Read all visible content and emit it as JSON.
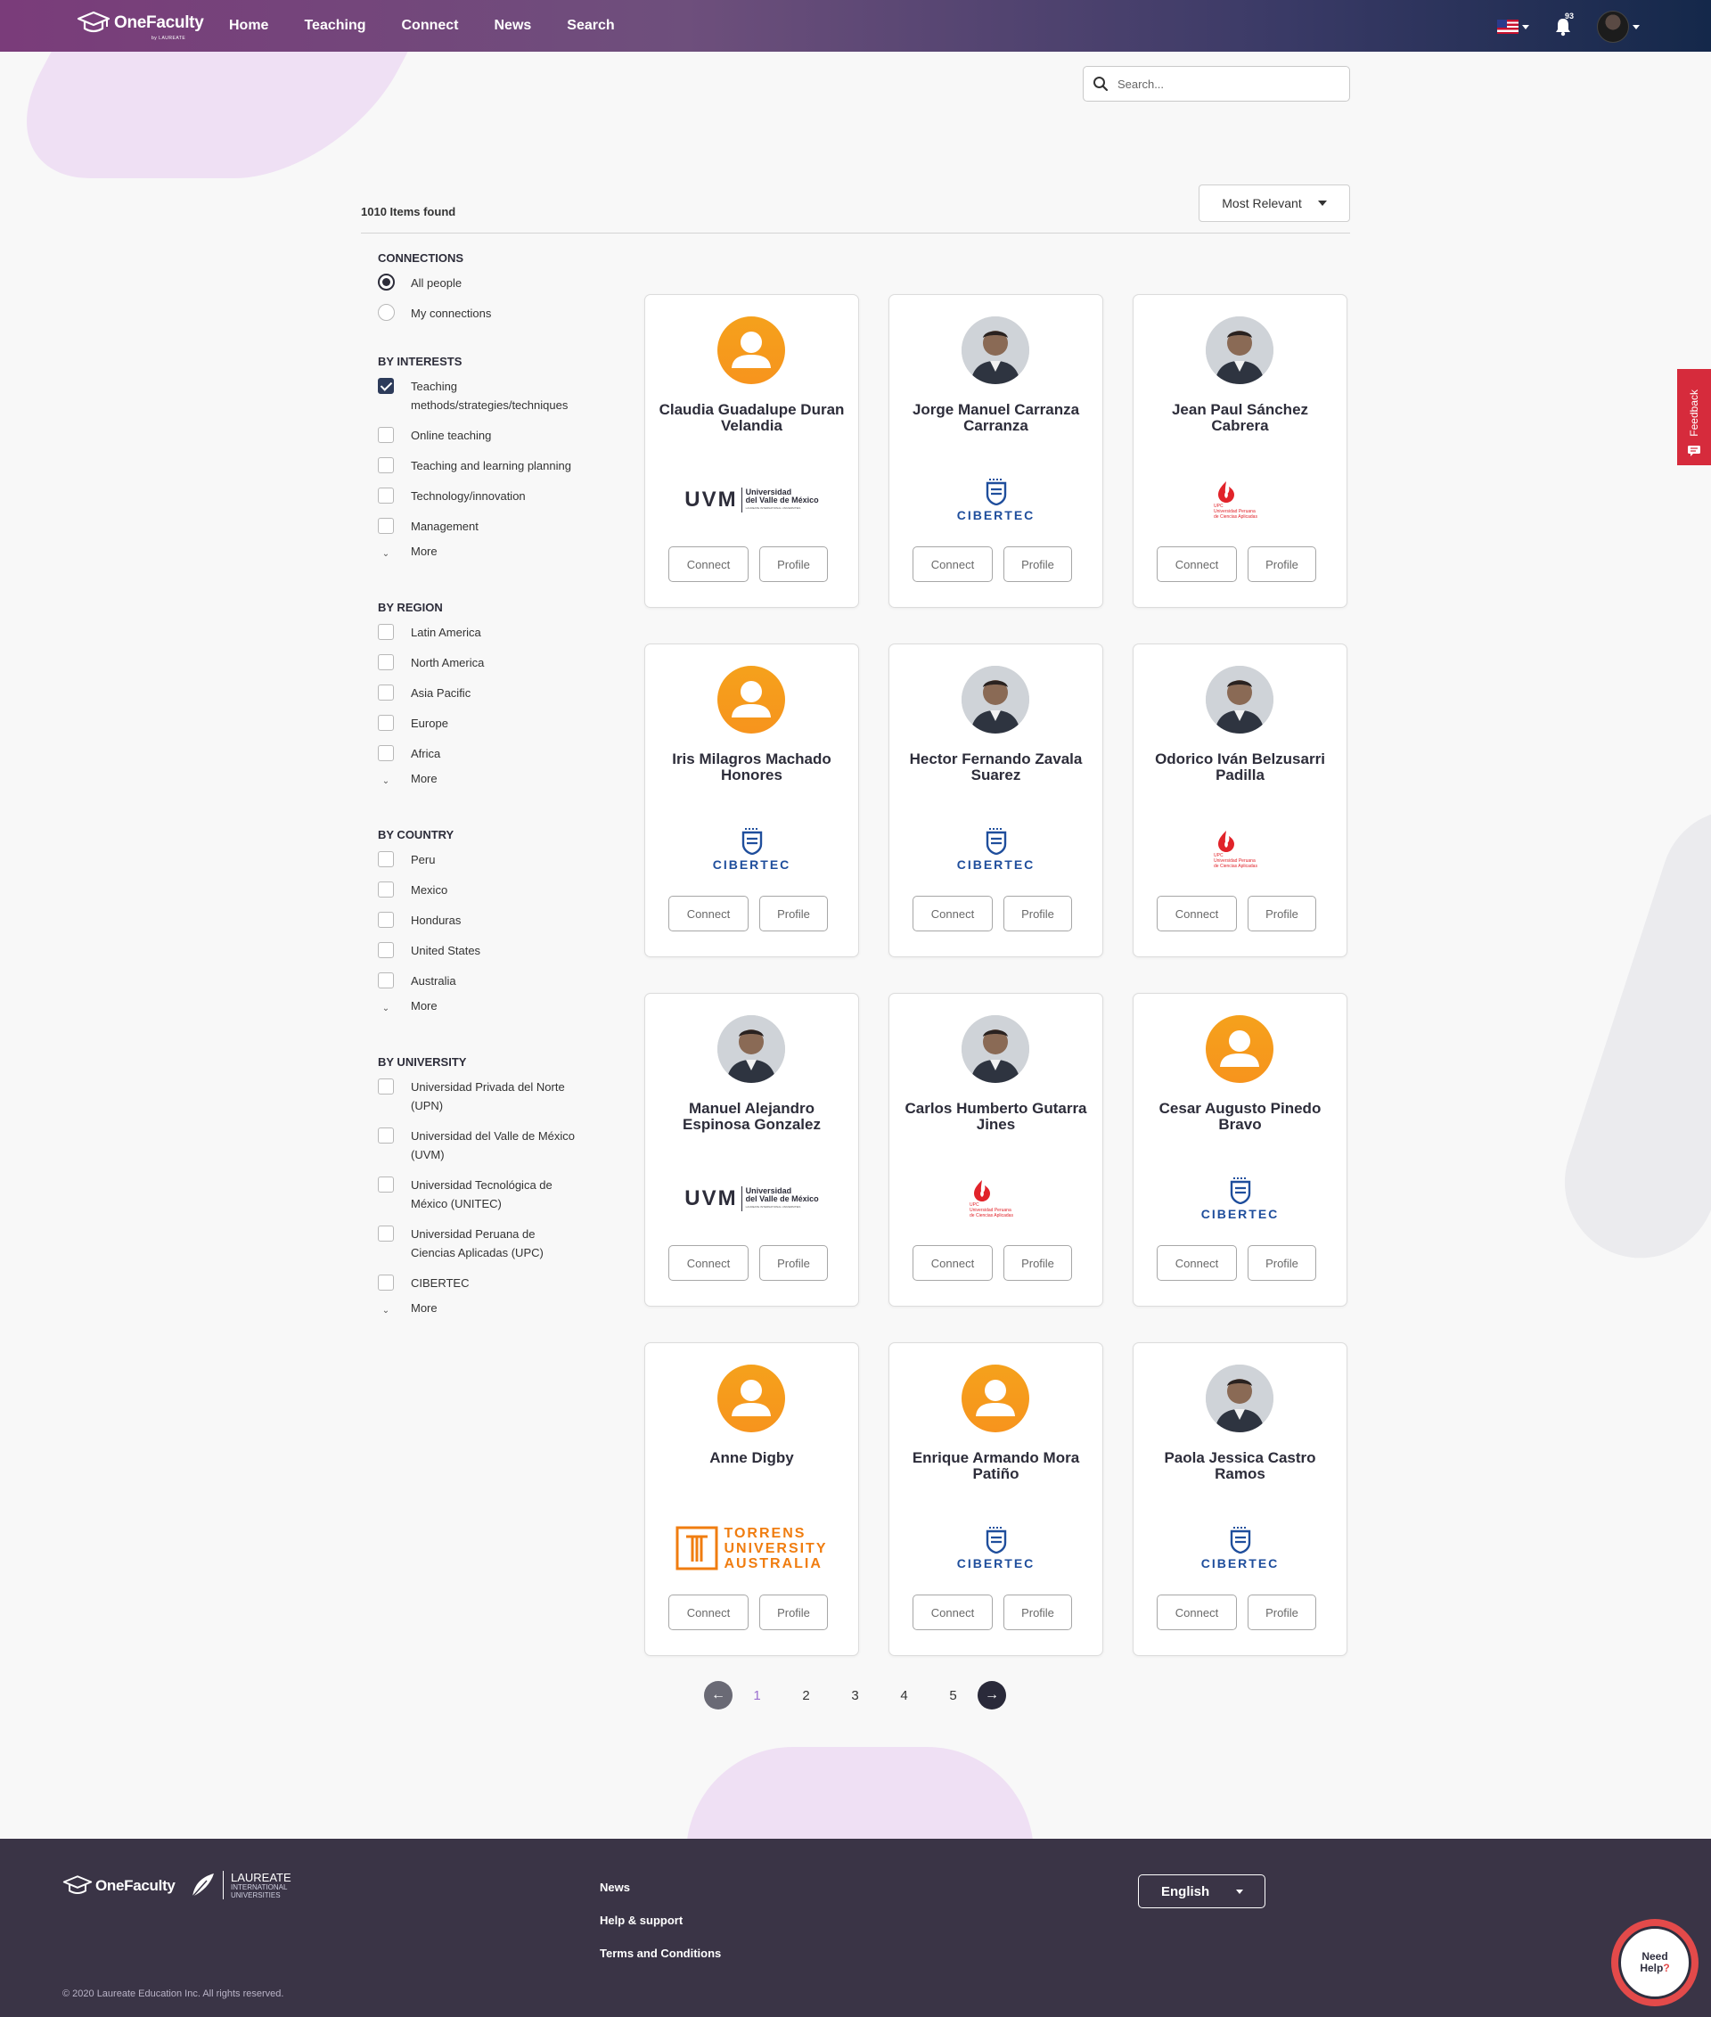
{
  "brand": {
    "name": "OneFaculty",
    "sub": "by LAUREATE"
  },
  "nav": {
    "items": [
      "Home",
      "Teaching",
      "Connect",
      "News",
      "Search"
    ]
  },
  "header": {
    "notifications": "93"
  },
  "search": {
    "placeholder": "Search..."
  },
  "results": {
    "count_label": "1010 Items found",
    "sort_label": "Most Relevant"
  },
  "filters": {
    "connections": {
      "title": "CONNECTIONS",
      "options": [
        "All people",
        "My connections"
      ],
      "selected": "All people"
    },
    "interests": {
      "title": "BY INTERESTS",
      "options": [
        "Teaching methods/strategies/techniques",
        "Online teaching",
        "Teaching and learning planning",
        "Technology/innovation",
        "Management"
      ],
      "checked": [
        "Teaching methods/strategies/techniques"
      ],
      "more": "More"
    },
    "region": {
      "title": "BY REGION",
      "options": [
        "Latin America",
        "North America",
        "Asia Pacific",
        "Europe",
        "Africa"
      ],
      "more": "More"
    },
    "country": {
      "title": "BY COUNTRY",
      "options": [
        "Peru",
        "Mexico",
        "Honduras",
        "United States",
        "Australia"
      ],
      "more": "More"
    },
    "university": {
      "title": "BY UNIVERSITY",
      "options": [
        "Universidad Privada del Norte (UPN)",
        "Universidad del Valle de México (UVM)",
        "Universidad Tecnológica de México (UNITEC)",
        "Universidad Peruana de Ciencias Aplicadas (UPC)",
        "CIBERTEC"
      ],
      "more": "More"
    }
  },
  "card_labels": {
    "connect": "Connect",
    "profile": "Profile"
  },
  "people": [
    {
      "name": "Claudia Guadalupe Duran Velandia",
      "avatar": "generic",
      "university": "uvm"
    },
    {
      "name": "Jorge Manuel Carranza Carranza",
      "avatar": "photo",
      "university": "cibertec"
    },
    {
      "name": "Jean Paul Sánchez Cabrera",
      "avatar": "photo",
      "university": "upc"
    },
    {
      "name": "Iris Milagros Machado Honores",
      "avatar": "generic",
      "university": "cibertec"
    },
    {
      "name": "Hector Fernando Zavala Suarez",
      "avatar": "photo",
      "university": "cibertec"
    },
    {
      "name": "Odorico Iván Belzusarri Padilla",
      "avatar": "photo",
      "university": "upc"
    },
    {
      "name": "Manuel Alejandro Espinosa Gonzalez",
      "avatar": "photo",
      "university": "uvm"
    },
    {
      "name": "Carlos Humberto Gutarra Jines",
      "avatar": "photo",
      "university": "upc"
    },
    {
      "name": "Cesar Augusto Pinedo Bravo",
      "avatar": "generic",
      "university": "cibertec"
    },
    {
      "name": "Anne Digby",
      "avatar": "generic",
      "university": "torrens"
    },
    {
      "name": "Enrique Armando Mora Patiño",
      "avatar": "generic",
      "university": "cibertec"
    },
    {
      "name": "Paola Jessica Castro Ramos",
      "avatar": "photo",
      "university": "cibertec"
    }
  ],
  "logos": {
    "uvm": {
      "mark": "UVM",
      "line1": "Universidad",
      "line2": "del Valle de México",
      "line3": "LAUREATE INTERNATIONAL UNIVERSITIES"
    },
    "cibertec": {
      "mark": "CIBERTEC"
    },
    "upc": {
      "line1": "UPC",
      "line2": "Universidad Peruana",
      "line3": "de Ciencias Aplicadas"
    },
    "torrens": {
      "line1": "TORRENS",
      "line2": "UNIVERSITY",
      "line3": "AUSTRALIA"
    }
  },
  "pagination": {
    "pages": [
      "1",
      "2",
      "3",
      "4",
      "5"
    ],
    "active": "1"
  },
  "feedback": {
    "label": "Feedback"
  },
  "footer": {
    "brand": "OneFaculty",
    "laureate_title": "LAUREATE",
    "laureate_sub1": "INTERNATIONAL",
    "laureate_sub2": "UNIVERSITIES",
    "links": [
      "News",
      "Help & support",
      "Terms and Conditions"
    ],
    "language": "English",
    "copyright": "© 2020 Laureate Education Inc. All rights reserved."
  },
  "help": {
    "line1": "Need",
    "line2": "Help"
  },
  "colors": {
    "accent": "#9b6fcf",
    "header_start": "#7a3c7a",
    "header_end": "#14284a",
    "avatar_orange": "#f7941d",
    "cibertec_blue": "#1f4e9c",
    "upc_red": "#e1232a",
    "torrens_orange": "#f07d10",
    "footer_bg": "#3a3446"
  }
}
